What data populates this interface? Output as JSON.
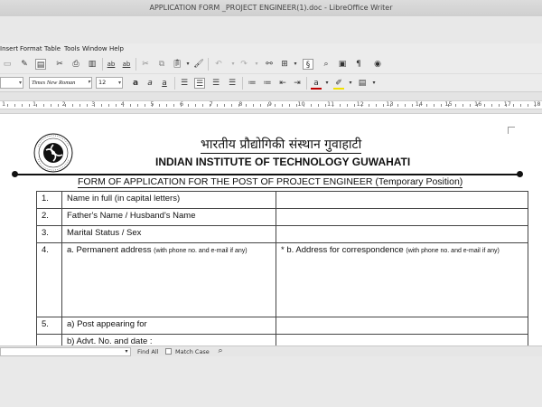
{
  "window": {
    "title": "APPLICATION FORM _PROJECT ENGINEER(1).doc - LibreOffice Writer"
  },
  "menu": [
    "Insert",
    "Format",
    "Table",
    "Tools",
    "Window",
    "Help"
  ],
  "format_toolbar": {
    "font_name": "Times New Roman",
    "font_size": "12"
  },
  "ruler": {
    "numbers": [
      "1",
      "1",
      "2",
      "3",
      "4",
      "5",
      "6",
      "7",
      "8",
      "9",
      "10",
      "11",
      "12",
      "13",
      "14",
      "15",
      "16",
      "17",
      "18"
    ]
  },
  "document": {
    "hindi_title": "भारतीय प्रौद्योगिकी संस्थान गुवाहाटी",
    "institute": "INDIAN INSTITUTE OF TECHNOLOGY GUWAHATI",
    "form_title": "FORM OF APPLICATION FOR THE POST OF PROJECT ENGINEER  (Temporary Position)",
    "rows": [
      {
        "num": "1.",
        "label": "Name in full (in capital letters)",
        "right": ""
      },
      {
        "num": "2.",
        "label": "Father's Name / Husband's Name",
        "right": ""
      },
      {
        "num": "3.",
        "label": "Marital Status / Sex",
        "right": ""
      },
      {
        "num": "4.",
        "label": "a. Permanent address ",
        "note": "(with phone no. and e-mail if any)",
        "right": "* b. Address for correspondence ",
        "right_note": "(with phone no. and e-mail if any)"
      },
      {
        "num": "5.",
        "label": "a) Post appearing for",
        "right": ""
      },
      {
        "num": "",
        "label": "b) Advt. No. and date :",
        "right": ""
      }
    ]
  },
  "findbar": {
    "find_all": "Find All",
    "match_case": "Match Case"
  },
  "colors": {
    "font_color": "#c00000",
    "highlight": "#f2e100"
  }
}
